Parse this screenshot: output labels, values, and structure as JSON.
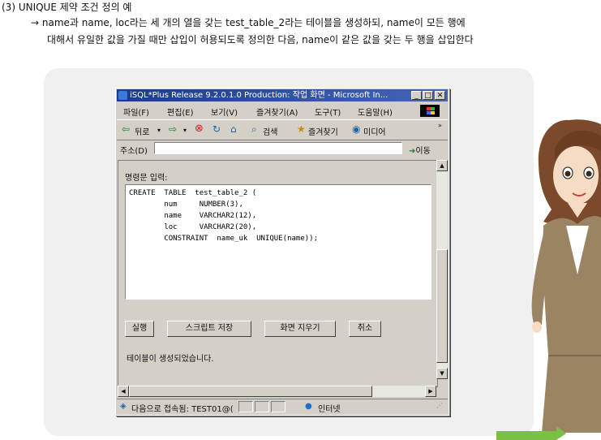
{
  "heading": "(3) UNIQUE 제약 조건 정의 예",
  "description_line1": "→ name과 name, loc라는 세 개의 열을 갖는 test_table_2라는 테이블을 생성하되, name이 모든 행에",
  "description_line2": "대해서 유일한 값을 가질 때만 삽입이 허용되도록 정의한 다음, name이 같은 값을 갖는 두 행을 삽입한다",
  "window": {
    "title": "iSQL*Plus Release 9.2.0.1.0 Production: 작업 화면 - Microsoft In...",
    "menu": [
      "파일(F)",
      "편집(E)",
      "보기(V)",
      "즐겨찾기(A)",
      "도구(T)",
      "도움말(H)"
    ],
    "toolbar": {
      "back": "뒤로",
      "search": "검색",
      "favorites": "즐겨찾기",
      "media": "미디어"
    },
    "address_label": "주소(D)",
    "address_value": "",
    "go_label": "이동",
    "command_label": "명령문 입력:",
    "sql": "CREATE  TABLE  test_table_2 (\n        num     NUMBER(3),\n        name    VARCHAR2(12),\n        loc     VARCHAR2(20),\n        CONSTRAINT  name_uk  UNIQUE(name));",
    "buttons": {
      "execute": "실행",
      "save_script": "스크립트 저장",
      "clear_screen": "화면 지우기",
      "cancel": "취소"
    },
    "result_message": "테이블이 생성되었습니다.",
    "status_text": "다음으로 접속됨: TEST01@(",
    "zone": "인터넷"
  }
}
